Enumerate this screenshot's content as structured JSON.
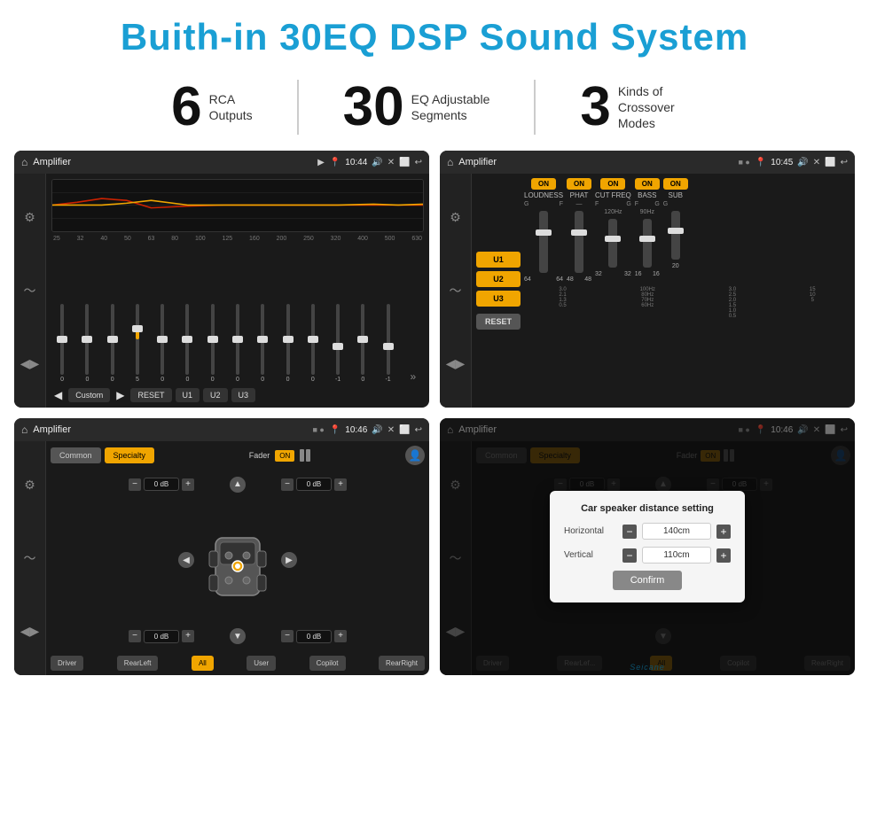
{
  "header": {
    "title": "Buith-in 30EQ DSP Sound System"
  },
  "stats": [
    {
      "num": "6",
      "label_line1": "RCA",
      "label_line2": "Outputs"
    },
    {
      "num": "30",
      "label_line1": "EQ Adjustable",
      "label_line2": "Segments"
    },
    {
      "num": "3",
      "label_line1": "Kinds of",
      "label_line2": "Crossover Modes"
    }
  ],
  "screens": {
    "screen1": {
      "title": "Amplifier",
      "time": "10:44",
      "freq_labels": [
        "25",
        "32",
        "40",
        "50",
        "63",
        "80",
        "100",
        "125",
        "160",
        "200",
        "250",
        "320",
        "400",
        "500",
        "630"
      ],
      "sliders": [
        {
          "val": "0",
          "offset": 0
        },
        {
          "val": "0",
          "offset": 0
        },
        {
          "val": "0",
          "offset": 0
        },
        {
          "val": "5",
          "offset": -10
        },
        {
          "val": "0",
          "offset": 0
        },
        {
          "val": "0",
          "offset": 0
        },
        {
          "val": "0",
          "offset": 0
        },
        {
          "val": "0",
          "offset": 0
        },
        {
          "val": "0",
          "offset": 0
        },
        {
          "val": "0",
          "offset": 0
        },
        {
          "val": "0",
          "offset": 0
        },
        {
          "val": "-1",
          "offset": 5
        },
        {
          "val": "0",
          "offset": 0
        },
        {
          "val": "-1",
          "offset": 5
        }
      ],
      "buttons": {
        "reset": "RESET",
        "u1": "U1",
        "u2": "U2",
        "u3": "U3",
        "preset": "Custom"
      }
    },
    "screen2": {
      "title": "Amplifier",
      "time": "10:45",
      "u_buttons": [
        "U1",
        "U2",
        "U3"
      ],
      "reset": "RESET",
      "controls": [
        "LOUDNESS",
        "PHAT",
        "CUT FREQ",
        "BASS",
        "SUB"
      ]
    },
    "screen3": {
      "title": "Amplifier",
      "time": "10:46",
      "tab_common": "Common",
      "tab_specialty": "Specialty",
      "fader_label": "Fader",
      "fader_on": "ON",
      "db_values": [
        "0 dB",
        "0 dB",
        "0 dB",
        "0 dB"
      ],
      "pos_buttons": {
        "driver": "Driver",
        "rearLeft": "RearLeft",
        "all": "All",
        "user": "User",
        "copilot": "Copilot",
        "rearRight": "RearRight"
      }
    },
    "screen4": {
      "title": "Amplifier",
      "time": "10:46",
      "tab_common": "Common",
      "tab_specialty": "Specialty",
      "dialog": {
        "title": "Car speaker distance setting",
        "horizontal_label": "Horizontal",
        "horizontal_value": "140cm",
        "vertical_label": "Vertical",
        "vertical_value": "110cm",
        "confirm_label": "Confirm"
      },
      "db_values": [
        "0 dB",
        "0 dB"
      ],
      "pos_buttons": {
        "driver": "Driver",
        "rearLeft": "RearLef...",
        "copilot": "Copilot",
        "rearRight": "RearRight"
      }
    }
  },
  "watermark": "Seicane"
}
